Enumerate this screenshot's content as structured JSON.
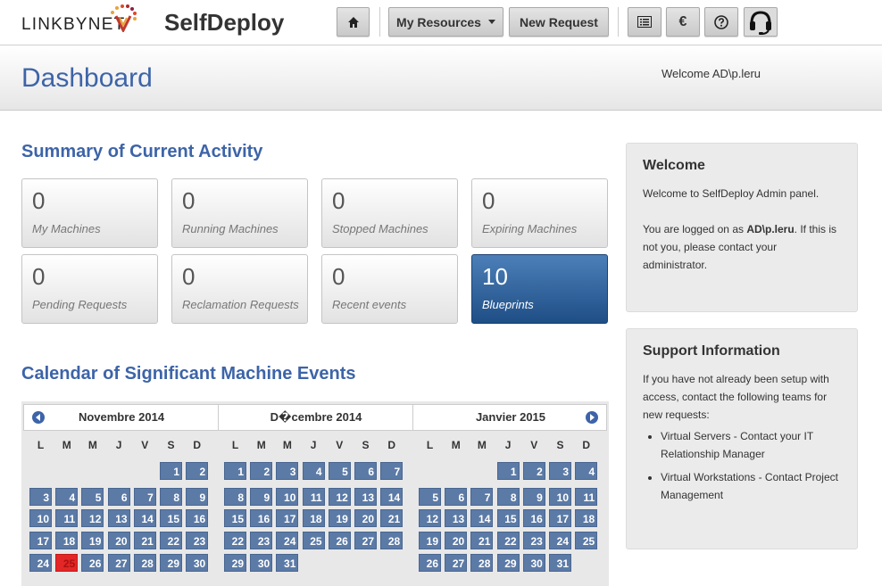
{
  "brand": {
    "logo_text": "LINKBYNET",
    "app_name": "SelfDeploy"
  },
  "nav": {
    "home_icon": "home-icon",
    "my_resources": "My Resources",
    "new_request": "New Request",
    "list_icon": "list-icon",
    "euro_label": "€",
    "help_icon": "help-icon",
    "support_icon": "headset-icon"
  },
  "header": {
    "title": "Dashboard",
    "welcome": "Welcome AD\\p.leru"
  },
  "summary": {
    "heading": "Summary of Current Activity",
    "tiles": [
      {
        "value": "0",
        "label": "My Machines"
      },
      {
        "value": "0",
        "label": "Running Machines"
      },
      {
        "value": "0",
        "label": "Stopped Machines"
      },
      {
        "value": "0",
        "label": "Expiring Machines"
      },
      {
        "value": "0",
        "label": "Pending Requests"
      },
      {
        "value": "0",
        "label": "Reclamation Requests"
      },
      {
        "value": "0",
        "label": "Recent events"
      },
      {
        "value": "10",
        "label": "Blueprints"
      }
    ]
  },
  "calendar": {
    "heading": "Calendar of Significant Machine Events",
    "weekdays": [
      "L",
      "M",
      "M",
      "J",
      "V",
      "S",
      "D"
    ],
    "today_color": "#e32626",
    "day_color": "#5b7aa6",
    "months": [
      {
        "name": "Novembre 2014",
        "first_weekday": 5,
        "days": 30,
        "today": 25
      },
      {
        "name": "D�cembre 2014",
        "first_weekday": 0,
        "days": 31,
        "today": null
      },
      {
        "name": "Janvier 2015",
        "first_weekday": 3,
        "days": 31,
        "today": null
      }
    ]
  },
  "welcome_panel": {
    "title": "Welcome",
    "intro": "Welcome to SelfDeploy Admin panel.",
    "logged_prefix": "You are logged on as ",
    "user": "AD\\p.leru",
    "logged_suffix": ". If this is not you, please contact your administrator."
  },
  "support_panel": {
    "title": "Support Information",
    "intro": "If you have not already been setup with access, contact the following teams for new requests:",
    "items": [
      "Virtual Servers - Contact your IT Relationship Manager",
      "Virtual Workstations - Contact Project Management"
    ]
  },
  "colors": {
    "accent": "#3d64a8",
    "tile_active": "#2a5a93"
  }
}
